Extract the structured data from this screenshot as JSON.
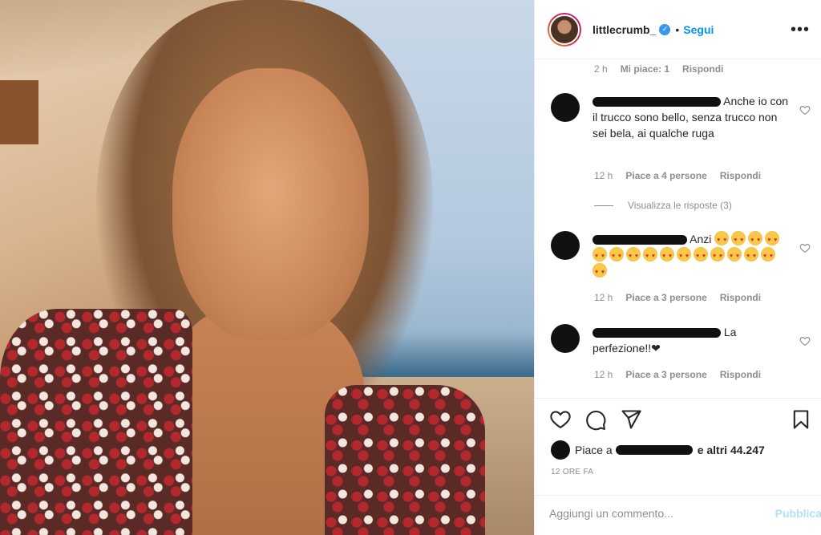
{
  "header": {
    "username": "littlecrumb_",
    "separator": "•",
    "follow_label": "Segui",
    "more_label": "•••"
  },
  "top_meta": {
    "time": "2 h",
    "likes": "Mi piace: 1",
    "reply": "Rispondi"
  },
  "comments": [
    {
      "text": "Anche io con il trucco sono bello, senza trucco non sei bela, ai qualche ruga",
      "time": "12 h",
      "likes": "Piace a 4 persone",
      "reply": "Rispondi",
      "replies_label": "Visualizza le risposte (3)"
    },
    {
      "text": "Anzi",
      "emoji_count": 16,
      "time": "12 h",
      "likes": "Piace a 3 persone",
      "reply": "Rispondi"
    },
    {
      "text_a": "La",
      "text_b": "perfezione!!❤",
      "time": "12 h",
      "likes": "Piace a 3 persone",
      "reply": "Rispondi"
    }
  ],
  "actions": {
    "likes_prefix": "Piace a",
    "likes_suffix": "e altri 44.247",
    "timestamp": "12 ORE FA",
    "add_comment_placeholder": "Aggiungi un commento...",
    "publish_label": "Pubblica"
  },
  "colors": {
    "accent": "#0095f6",
    "muted": "#8e8e8e",
    "publish_disabled": "#b2dffc"
  }
}
